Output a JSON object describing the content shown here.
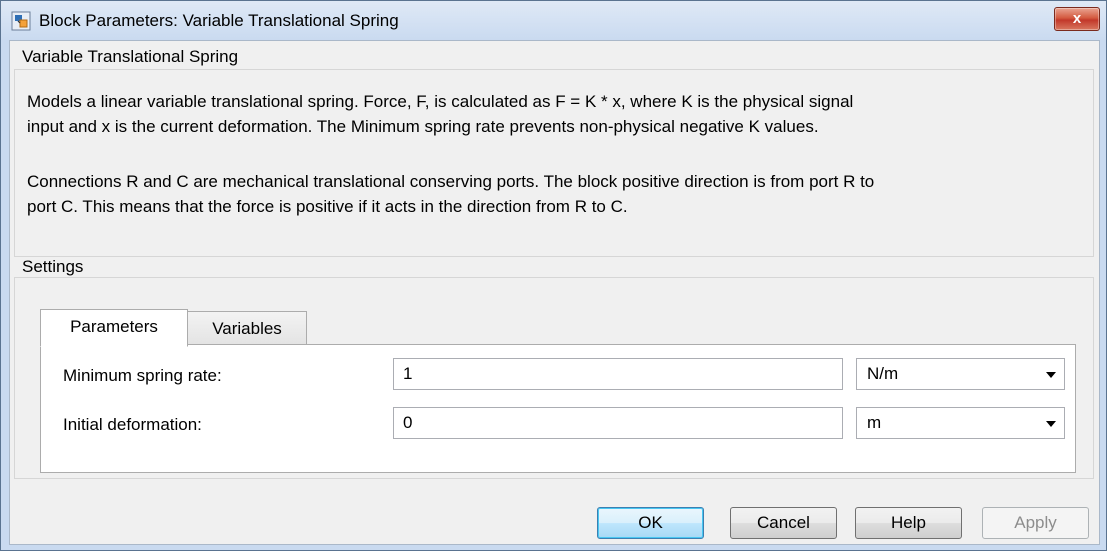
{
  "window": {
    "title": "Block Parameters: Variable Translational Spring",
    "close_label": "x"
  },
  "description": {
    "heading": "Variable Translational Spring",
    "paragraph1_line1": "Models a linear variable translational spring. Force, F, is calculated as F = K * x, where K is the physical signal",
    "paragraph1_line2": "input and x is the current deformation. The Minimum spring rate prevents non-physical negative K values.",
    "paragraph2_line1": "Connections R and C are mechanical translational conserving ports. The block positive direction is from port R to",
    "paragraph2_line2": "port C. This means that the force is positive if it acts in the direction from R to C."
  },
  "settings": {
    "heading": "Settings",
    "tabs": [
      {
        "label": "Parameters",
        "active": true
      },
      {
        "label": "Variables",
        "active": false
      }
    ],
    "rows": [
      {
        "label": "Minimum spring rate:",
        "value": "1",
        "unit": "N/m"
      },
      {
        "label": "Initial deformation:",
        "value": "0",
        "unit": "m"
      }
    ]
  },
  "buttons": {
    "ok": "OK",
    "cancel": "Cancel",
    "help": "Help",
    "apply": "Apply"
  },
  "colors": {
    "title_bar": "#c9daf0",
    "close_button": "#c2382a",
    "default_button_border": "#3c7fb1"
  }
}
